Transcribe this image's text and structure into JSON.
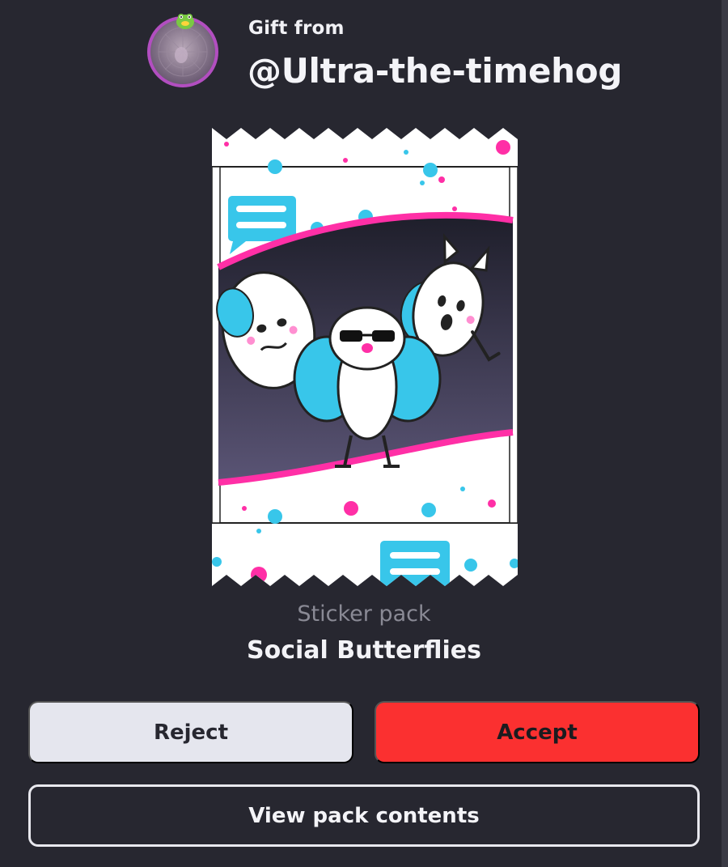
{
  "header": {
    "label": "Gift from",
    "sender": "@Ultra-the-timehog",
    "avatar_icon": "frog-face-avatar"
  },
  "pack": {
    "type": "Sticker pack",
    "name": "Social Butterflies",
    "colors": {
      "pink": "#ff2fa6",
      "cyan": "#38c6ea",
      "dark": "#262633"
    }
  },
  "actions": {
    "reject_label": "Reject",
    "accept_label": "Accept",
    "view_label": "View pack contents"
  },
  "colors": {
    "background": "#272730",
    "accept": "#fb3030",
    "reject": "#e5e6ee"
  }
}
